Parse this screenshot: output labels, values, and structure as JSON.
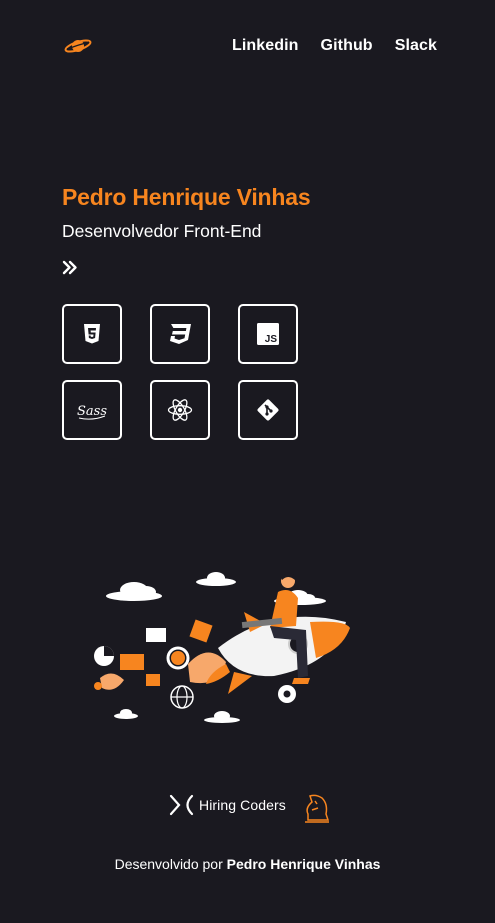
{
  "header": {
    "logo_icon": "saturn-planet-icon",
    "nav": [
      {
        "label": "Linkedin"
      },
      {
        "label": "Github"
      },
      {
        "label": "Slack"
      }
    ]
  },
  "hero": {
    "name": "Pedro Henrique Vinhas",
    "role": "Desenvolvedor Front-End",
    "arrow_icon": "double-chevron-right-icon"
  },
  "skills": [
    {
      "icon": "html5-icon"
    },
    {
      "icon": "css3-icon"
    },
    {
      "icon": "javascript-icon",
      "text": "JS"
    },
    {
      "icon": "sass-icon",
      "text": "Sass"
    },
    {
      "icon": "react-icon"
    },
    {
      "icon": "git-icon"
    }
  ],
  "illustration": {
    "icon": "rocket-developer-illustration"
  },
  "brand": {
    "text": "Hiring Coders",
    "icon": "chess-knight-icon"
  },
  "footer": {
    "prefix": "Desenvolvido por ",
    "author": "Pedro Henrique Vinhas"
  },
  "colors": {
    "background": "#1a1920",
    "accent": "#f7851f",
    "text": "#ffffff"
  }
}
